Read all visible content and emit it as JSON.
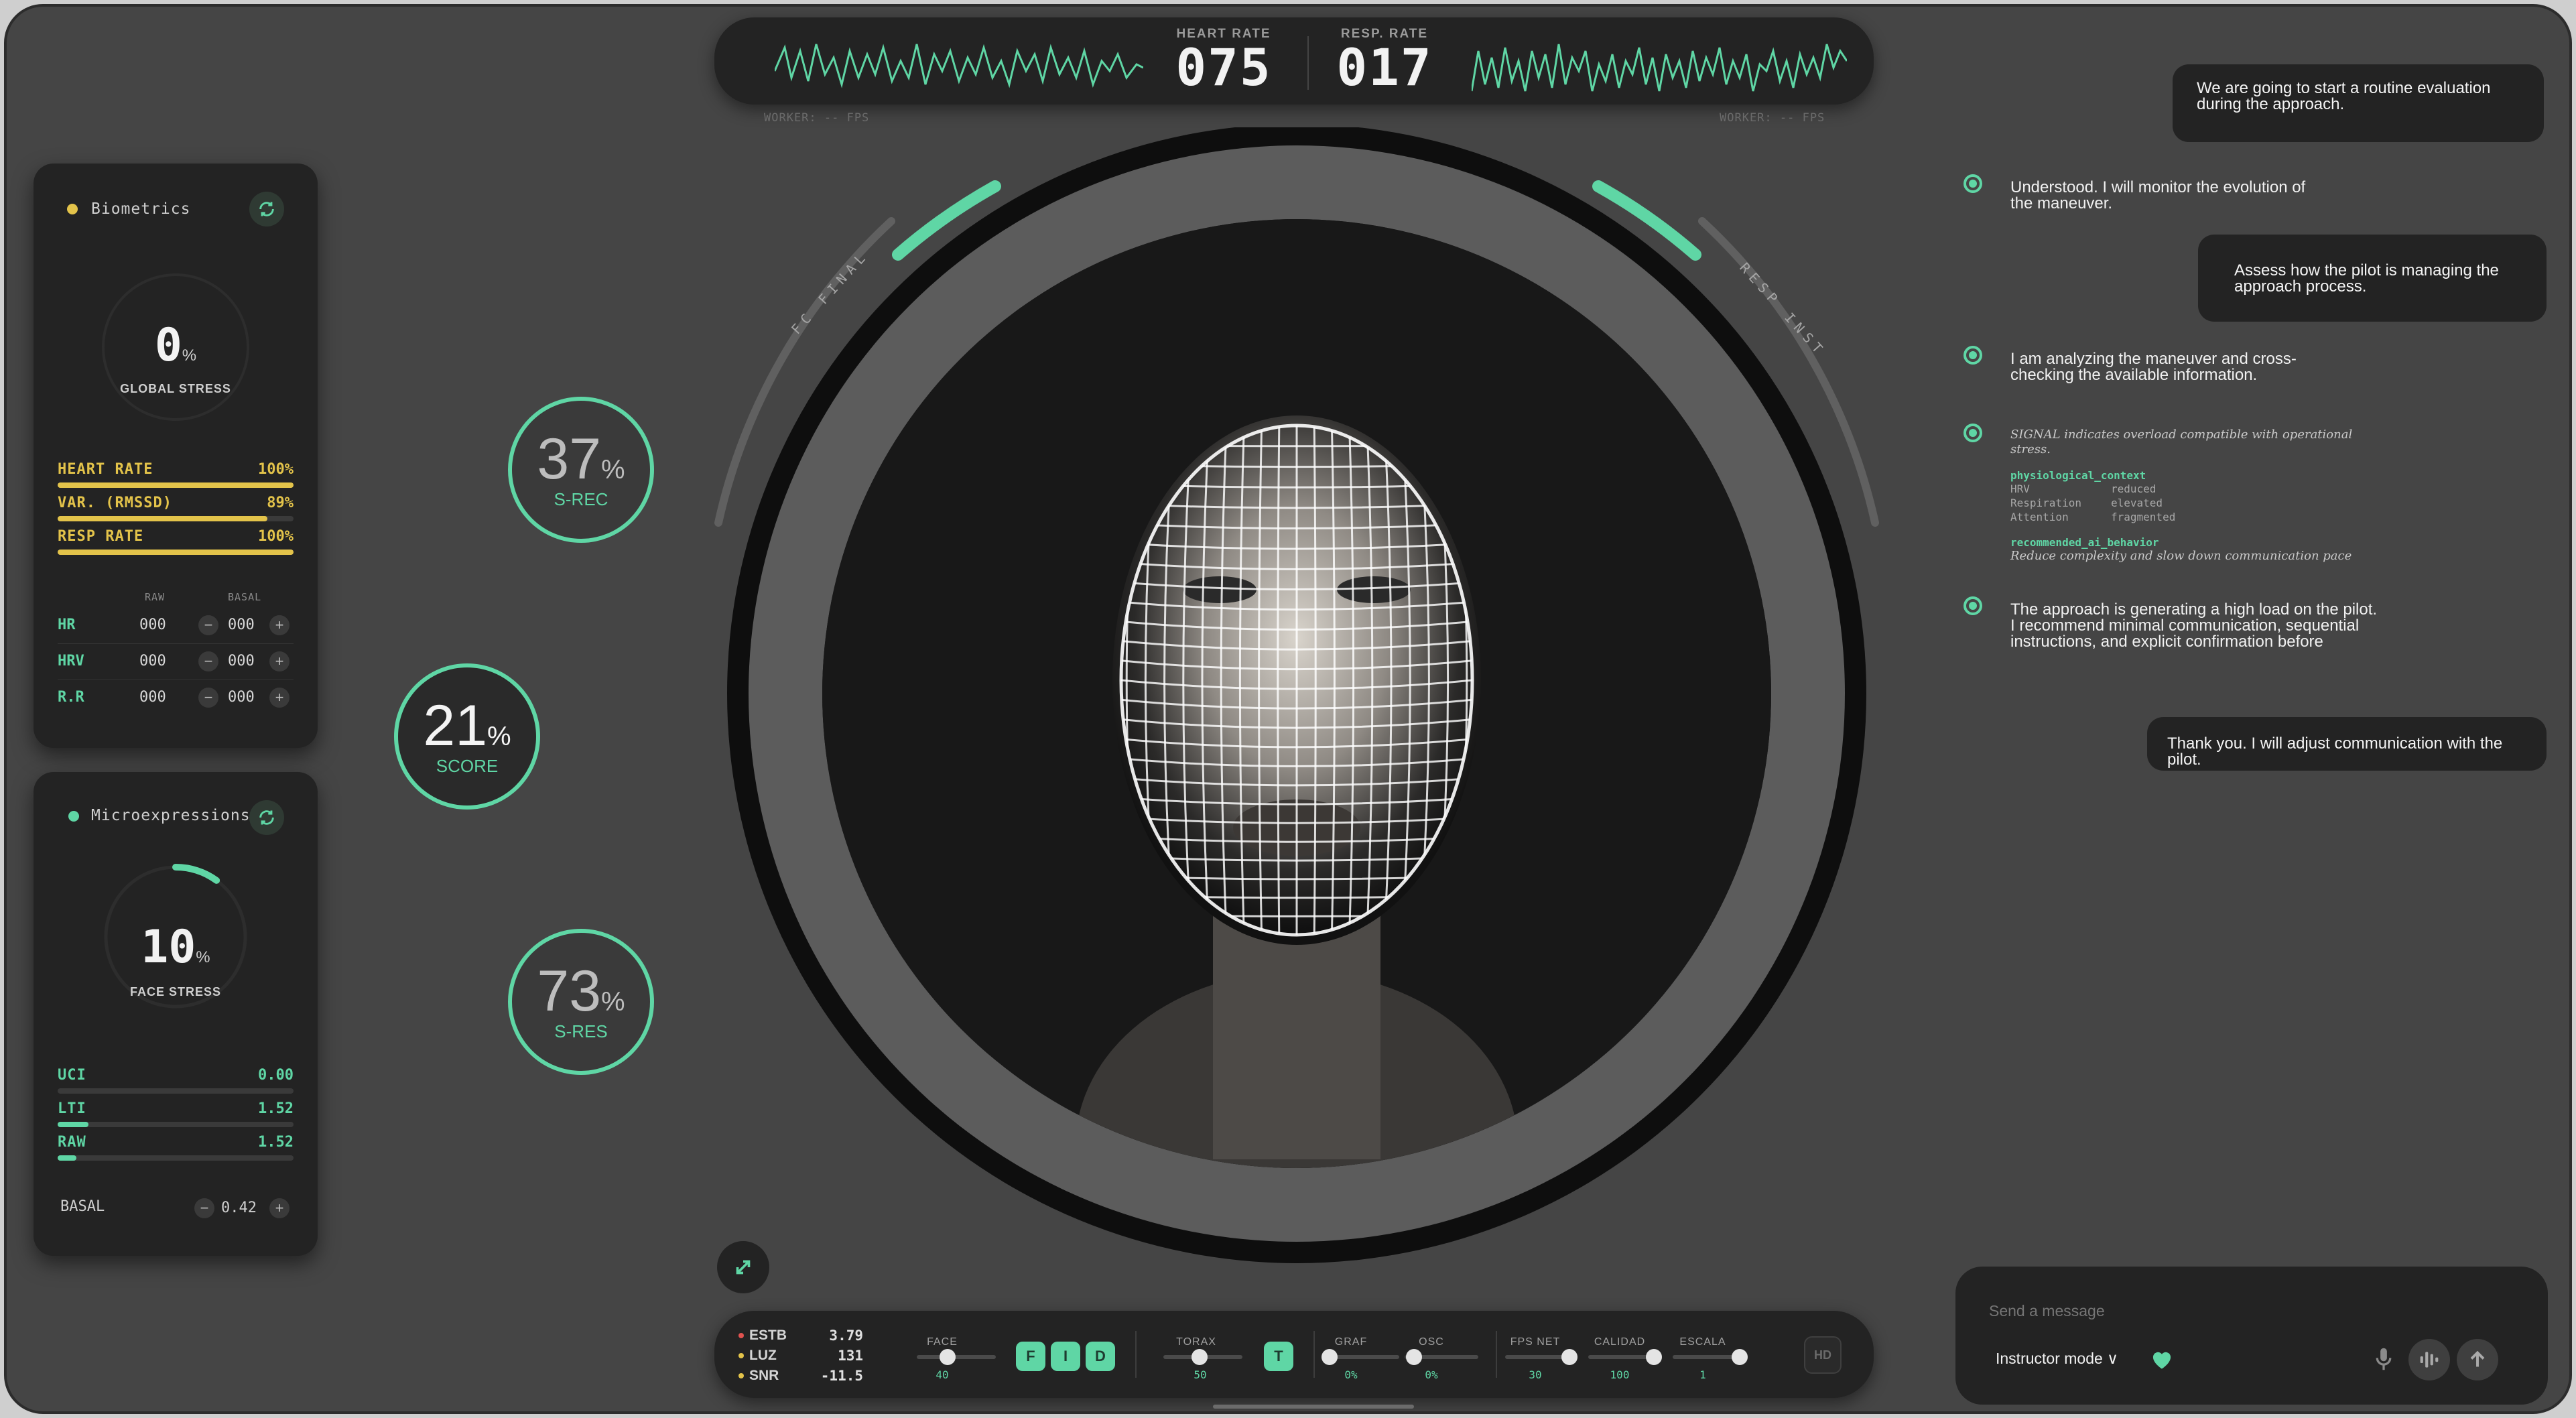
{
  "vitals": {
    "heart_rate_label": "HEART RATE",
    "heart_rate_value": "075",
    "resp_rate_label": "RESP. RATE",
    "resp_rate_value": "017",
    "worker_left": "WORKER: -- FPS",
    "worker_right": "WORKER: -- FPS"
  },
  "biometrics": {
    "title": "Biometrics",
    "stress_value": "0",
    "stress_unit": "%",
    "stress_label": "GLOBAL STRESS",
    "metrics": [
      {
        "name": "HEART RATE",
        "value": "100%",
        "fraction": 1.0
      },
      {
        "name": "VAR. (RMSSD)",
        "value": "89%",
        "fraction": 0.89
      },
      {
        "name": "RESP RATE",
        "value": "100%",
        "fraction": 1.0
      }
    ],
    "col_raw": "RAW",
    "col_basal": "BASAL",
    "rows": [
      {
        "label": "HR",
        "raw": "000",
        "basal": "000"
      },
      {
        "label": "HRV",
        "raw": "000",
        "basal": "000"
      },
      {
        "label": "R.R",
        "raw": "000",
        "basal": "000"
      }
    ]
  },
  "micro": {
    "title": "Microexpressions",
    "stress_value": "10",
    "stress_unit": "%",
    "stress_label": "FACE STRESS",
    "stress_fraction": 0.1,
    "metrics": [
      {
        "name": "UCI",
        "value": "0.00",
        "fraction": 0.0
      },
      {
        "name": "LTI",
        "value": "1.52",
        "fraction": 0.13
      },
      {
        "name": "RAW",
        "value": "1.52",
        "fraction": 0.08
      }
    ],
    "basal_label": "BASAL",
    "basal_value": "0.42"
  },
  "scores": {
    "srec_value": "37",
    "srec_label": "S-REC",
    "score_value": "21",
    "score_label": "SCORE",
    "sres_value": "73",
    "sres_label": "S-RES",
    "pct": "%"
  },
  "arc_labels": {
    "left": "FC FINAL",
    "right": "RESP INST"
  },
  "chat": {
    "msg1": "We are going to start a routine evaluation during the approach.",
    "reply1": "Understood. I will monitor the evolution of the maneuver.",
    "msg2": "Assess how the pilot is managing the approach process.",
    "reply2": "I am analyzing the maneuver and cross-checking the available information.",
    "reply3_intro": "SIGNAL indicates overload compatible with operational stress.",
    "reply3_ctx_key": "physiological_context",
    "reply3_ctx": [
      {
        "k": "HRV",
        "v": "reduced"
      },
      {
        "k": "Respiration",
        "v": "elevated"
      },
      {
        "k": "Attention",
        "v": "fragmented"
      }
    ],
    "reply3_rec_key": "recommended_ai_behavior",
    "reply3_rec": "Reduce complexity and slow down communication pace",
    "reply4": "The approach is generating a high load on the pilot. I recommend minimal communication, sequential instructions, and explicit confirmation before continuing.",
    "msg3": "Thank you. I will adjust communication with the pilot.",
    "input_placeholder": "Send a message",
    "mode_label": "Instructor mode ∨"
  },
  "controls": {
    "status": [
      {
        "name": "ESTB",
        "value": "3.79",
        "color": "#e0524f"
      },
      {
        "name": "LUZ",
        "value": "131",
        "color": "#e3c34a"
      },
      {
        "name": "SNR",
        "value": "-11.5",
        "color": "#e3c34a"
      }
    ],
    "face_label": "FACE",
    "face_value": "40",
    "buttons": [
      "F",
      "I",
      "D"
    ],
    "torax_label": "TORAX",
    "torax_value": "50",
    "torax_btn": "T",
    "graf_label": "GRAF",
    "graf_value": "0%",
    "osc_label": "OSC",
    "osc_value": "0%",
    "fps_label": "FPS NET",
    "fps_value": "30",
    "calidad_label": "CALIDAD",
    "calidad_value": "100",
    "escala_label": "ESCALA",
    "escala_value": "1",
    "hd_label": "HD"
  },
  "colors": {
    "accent": "#5fd6a5",
    "warn": "#e3c34a",
    "panel": "#232323",
    "bg": "#454545"
  }
}
